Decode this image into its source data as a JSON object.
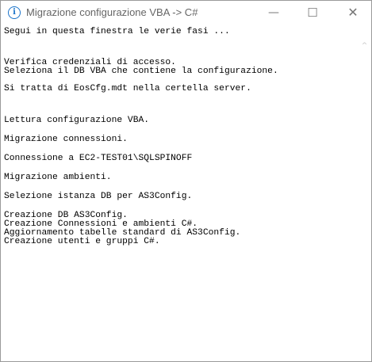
{
  "window": {
    "title": "Migrazione configurazione VBA -> C#",
    "icon": "info-icon",
    "controls": {
      "minimize": "—",
      "maximize": "☐",
      "close": "✕"
    }
  },
  "console": {
    "lines": [
      "Segui in questa finestra le verie fasi ...",
      "Verifica credenziali di accesso.",
      "Seleziona il DB VBA che contiene la configurazione.",
      "Si tratta di EosCfg.mdt nella certella server.",
      "Lettura configurazione VBA.",
      "Migrazione connessioni.",
      "Connessione a EC2-TEST01\\SQLSPINOFF",
      "Migrazione ambienti.",
      "Selezione istanza DB per AS3Config.",
      "Creazione DB AS3Config.",
      "Creazione Connessioni e ambienti C#.",
      "Aggiornamento tabelle standard di AS3Config.",
      "Creazione utenti e gruppi C#."
    ]
  },
  "scrollbar": {
    "up_arrow": "^"
  }
}
